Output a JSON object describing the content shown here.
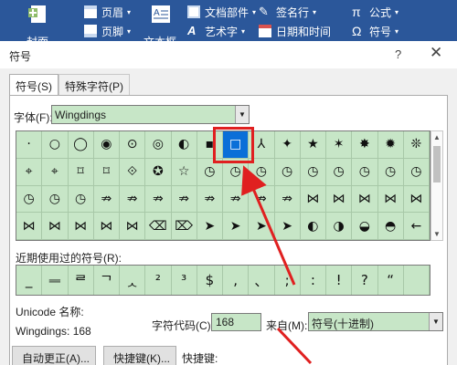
{
  "ribbon": {
    "cover_label": "封面",
    "header_label": "页眉",
    "footer_label": "页脚",
    "textbox_label": "文本框",
    "docparts_label": "文档部件",
    "wordart_label": "艺术字",
    "signature_label": "签名行",
    "datetime_label": "日期和时间",
    "equation_label": "公式",
    "symbol_label": "符号"
  },
  "dialog": {
    "title": "符号",
    "help": "?",
    "close": "✕",
    "tabs": [
      {
        "label": "符号(S)",
        "active": true
      },
      {
        "label": "特殊字符(P)",
        "active": false
      }
    ],
    "font_label": "字体(F):",
    "font_value": "Wingdings",
    "symbols": [
      "·",
      "○",
      "◯",
      "◉",
      "⊙",
      "◎",
      "◐",
      "▪",
      "□",
      "⅄",
      "✦",
      "★",
      "✶",
      "✸",
      "✹",
      "❊",
      "⌖",
      "⌖",
      "⌑",
      "⌑",
      "⟐",
      "✪",
      "☆",
      "◷",
      "◷",
      "◷",
      "◷",
      "◷",
      "◷",
      "◷",
      "◷",
      "◷",
      "◷",
      "◷",
      "◷",
      "⇏",
      "⇏",
      "⇏",
      "⇏",
      "⇏",
      "⇏",
      "⇏",
      "⇏",
      "⋈",
      "⋈",
      "⋈",
      "⋈",
      "⋈",
      "⋈",
      "⋈",
      "⋈",
      "⋈",
      "⋈",
      "⌫",
      "⌦",
      "➤",
      "➤",
      "➤",
      "➤",
      "◐",
      "◑",
      "◒",
      "◓",
      "←"
    ],
    "selected_index": 8,
    "recent_label": "近期使用过的符号(R):",
    "recent_symbols": [
      "_",
      "ᆖ",
      "ᄅ",
      "ᄀ",
      "ᆺ",
      "²",
      "³",
      "$",
      ",",
      "、",
      ";",
      ":",
      "!",
      "?",
      "“",
      ""
    ],
    "unicode_name_label": "Unicode 名称:",
    "unicode_value": "Wingdings: 168",
    "char_code_label": "字符代码(C):",
    "char_code_value": "168",
    "from_label": "来自(M):",
    "from_value": "符号(十进制)",
    "autocorrect_button": "自动更正(A)...",
    "shortcut_key_button": "快捷键(K)...",
    "shortcut_label": "快捷键:"
  }
}
